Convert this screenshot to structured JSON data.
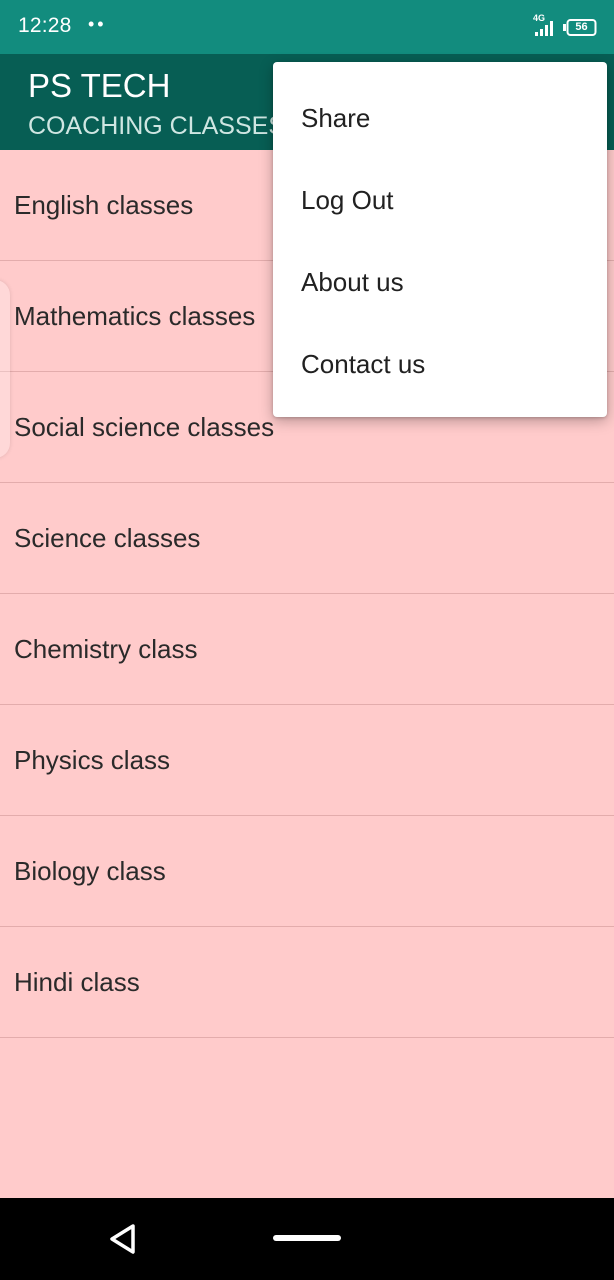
{
  "status_bar": {
    "time": "12:28",
    "dots": "••",
    "network": "4G",
    "battery": "56"
  },
  "app_bar": {
    "title": "PS TECH",
    "subtitle": "COACHING CLASSES"
  },
  "classes": [
    "English classes",
    "Mathematics classes",
    "Social science classes",
    "Science classes",
    "Chemistry class",
    "Physics class",
    "Biology class",
    "Hindi class"
  ],
  "menu": {
    "items": [
      "Share",
      "Log Out",
      "About us",
      "Contact us"
    ]
  },
  "colors": {
    "status_bar": "#128C7E",
    "app_bar": "#075E54",
    "list_background": "#FFCBCB",
    "menu_background": "#FFFFFF"
  },
  "icons": {
    "signal": "signal-icon",
    "battery": "battery-icon",
    "back": "back-triangle-icon",
    "home": "home-pill-icon"
  }
}
